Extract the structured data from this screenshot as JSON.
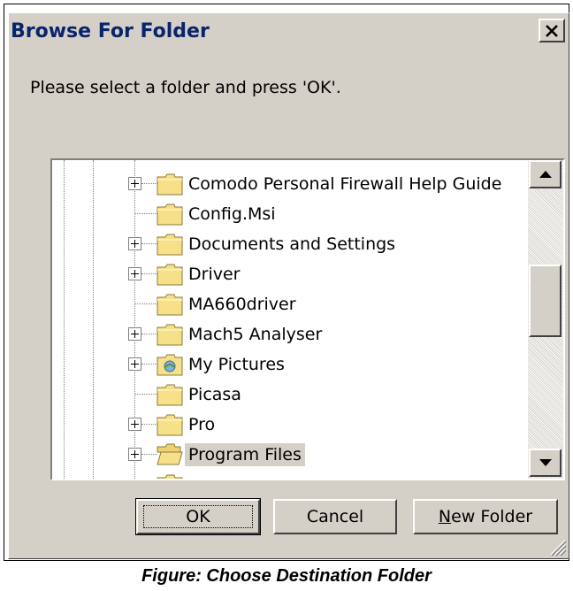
{
  "dialog": {
    "title": "Browse For Folder",
    "instruction": "Please select a folder and press 'OK'.",
    "close_symbol": "X"
  },
  "tree": {
    "items": [
      {
        "label": "Comodo Personal Firewall Help Guide",
        "expandable": true,
        "icon": "folder-icon",
        "selected": false
      },
      {
        "label": "Config.Msi",
        "expandable": false,
        "icon": "folder-icon",
        "selected": false
      },
      {
        "label": "Documents and Settings",
        "expandable": true,
        "icon": "folder-icon",
        "selected": false
      },
      {
        "label": "Driver",
        "expandable": true,
        "icon": "folder-icon",
        "selected": false
      },
      {
        "label": "MA660driver",
        "expandable": false,
        "icon": "folder-icon",
        "selected": false
      },
      {
        "label": "Mach5 Analyser",
        "expandable": true,
        "icon": "folder-icon",
        "selected": false
      },
      {
        "label": "My Pictures",
        "expandable": true,
        "icon": "pictures-folder-icon",
        "selected": false
      },
      {
        "label": "Picasa",
        "expandable": false,
        "icon": "folder-icon",
        "selected": false
      },
      {
        "label": "Pro",
        "expandable": true,
        "icon": "folder-icon",
        "selected": false
      },
      {
        "label": "Program Files",
        "expandable": true,
        "icon": "open-folder-icon",
        "selected": true
      }
    ]
  },
  "buttons": {
    "ok": "OK",
    "cancel": "Cancel",
    "new_folder_accel": "N",
    "new_folder_rest": "ew Folder"
  },
  "caption": "Figure: Choose Destination Folder",
  "colors": {
    "dialog_face": "#d4d0c8",
    "title_text": "#0a246a",
    "folder_yellow": "#f7e08a"
  }
}
